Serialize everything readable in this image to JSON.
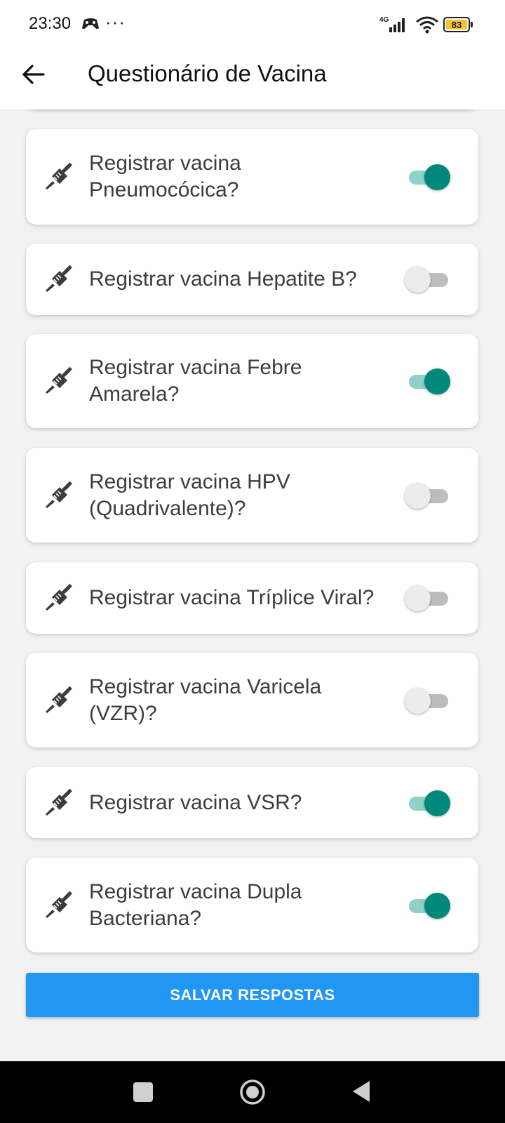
{
  "status_bar": {
    "time": "23:30",
    "more": "···",
    "network": "4G",
    "battery": "83"
  },
  "header": {
    "title": "Questionário de Vacina",
    "back_icon": "arrow-back-icon"
  },
  "vaccines": [
    {
      "label": "Registrar vacina\nPneumocócica?",
      "enabled": true
    },
    {
      "label": "Registrar vacina Hepatite B?",
      "enabled": false
    },
    {
      "label": "Registrar vacina Febre\nAmarela?",
      "enabled": true
    },
    {
      "label": "Registrar vacina HPV\n(Quadrivalente)?",
      "enabled": false
    },
    {
      "label": "Registrar vacina Tríplice Viral?",
      "enabled": false
    },
    {
      "label": "Registrar vacina Varicela\n(VZR)?",
      "enabled": false
    },
    {
      "label": "Registrar vacina VSR?",
      "enabled": true
    },
    {
      "label": "Registrar vacina Dupla\nBacteriana?",
      "enabled": true
    }
  ],
  "actions": {
    "save_label": "SALVAR RESPOSTAS"
  },
  "colors": {
    "accent_switch": "#00897b",
    "button": "#2196f3"
  },
  "icons": {
    "vaccine": "syringe-icon"
  }
}
